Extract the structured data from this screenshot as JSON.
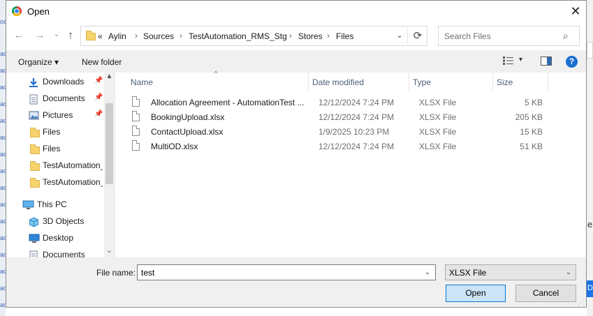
{
  "background": {
    "fragments": [
      "oa",
      "ac",
      "ac",
      "ac",
      "ac",
      "ac",
      "ac",
      "ac",
      "ac",
      "ac",
      "ac",
      "ac",
      "ac",
      "ac",
      "ac",
      "ac",
      "ac"
    ],
    "right_text": "e",
    "right_button": "D"
  },
  "dialog": {
    "title": "Open",
    "close_glyph": "✕"
  },
  "nav": {
    "back_glyph": "←",
    "forward_glyph": "→",
    "recent_glyph": "⌄",
    "up_glyph": "↑",
    "overflow": "«",
    "breadcrumbs": [
      "Aylin",
      "Sources",
      "TestAutomation_RMS_Stg",
      "Stores",
      "Files"
    ],
    "sep": "›",
    "refresh_glyph": "⟳",
    "search_placeholder": "Search Files",
    "search_glyph": "⌕"
  },
  "toolbar": {
    "organize": "Organize ▾",
    "new_folder": "New folder",
    "view_drop": "▾",
    "help": "?"
  },
  "sidebar": {
    "items": [
      {
        "label": "Downloads",
        "icon": "downloads-icon",
        "pinned": true
      },
      {
        "label": "Documents",
        "icon": "documents-icon",
        "pinned": true
      },
      {
        "label": "Pictures",
        "icon": "pictures-icon",
        "pinned": true
      },
      {
        "label": "Files",
        "icon": "folder-icon",
        "pinned": false
      },
      {
        "label": "Files",
        "icon": "folder-icon",
        "pinned": false
      },
      {
        "label": "TestAutomation_",
        "icon": "folder-icon",
        "pinned": false
      },
      {
        "label": "TestAutomation_",
        "icon": "folder-icon",
        "pinned": false
      },
      {
        "label": "This PC",
        "icon": "this-pc-icon",
        "pinned": false
      },
      {
        "label": "3D Objects",
        "icon": "3d-objects-icon",
        "pinned": false
      },
      {
        "label": "Desktop",
        "icon": "desktop-icon",
        "pinned": false
      },
      {
        "label": "Documents",
        "icon": "documents-icon",
        "pinned": false
      }
    ],
    "pin_glyph": "📌",
    "scroll_up": "▲",
    "scroll_down": "⌄"
  },
  "filelist": {
    "columns": {
      "name": "Name",
      "date": "Date modified",
      "type": "Type",
      "size": "Size"
    },
    "sort_glyph": "^",
    "files": [
      {
        "name": "Allocation Agreement - AutomationTest ...",
        "date": "12/12/2024 7:24 PM",
        "type": "XLSX File",
        "size": "5 KB"
      },
      {
        "name": "BookingUpload.xlsx",
        "date": "12/12/2024 7:24 PM",
        "type": "XLSX File",
        "size": "205 KB"
      },
      {
        "name": "ContactUpload.xlsx",
        "date": "1/9/2025 10:23 PM",
        "type": "XLSX File",
        "size": "15 KB"
      },
      {
        "name": "MultiOD.xlsx",
        "date": "12/12/2024 7:24 PM",
        "type": "XLSX File",
        "size": "51 KB"
      }
    ]
  },
  "bottom": {
    "file_name_label": "File name:",
    "file_name_value": "test",
    "file_type_value": "XLSX File",
    "dropdown_glyph": "⌄",
    "open_label": "Open",
    "cancel_label": "Cancel",
    "grip_glyph": "⋰"
  }
}
